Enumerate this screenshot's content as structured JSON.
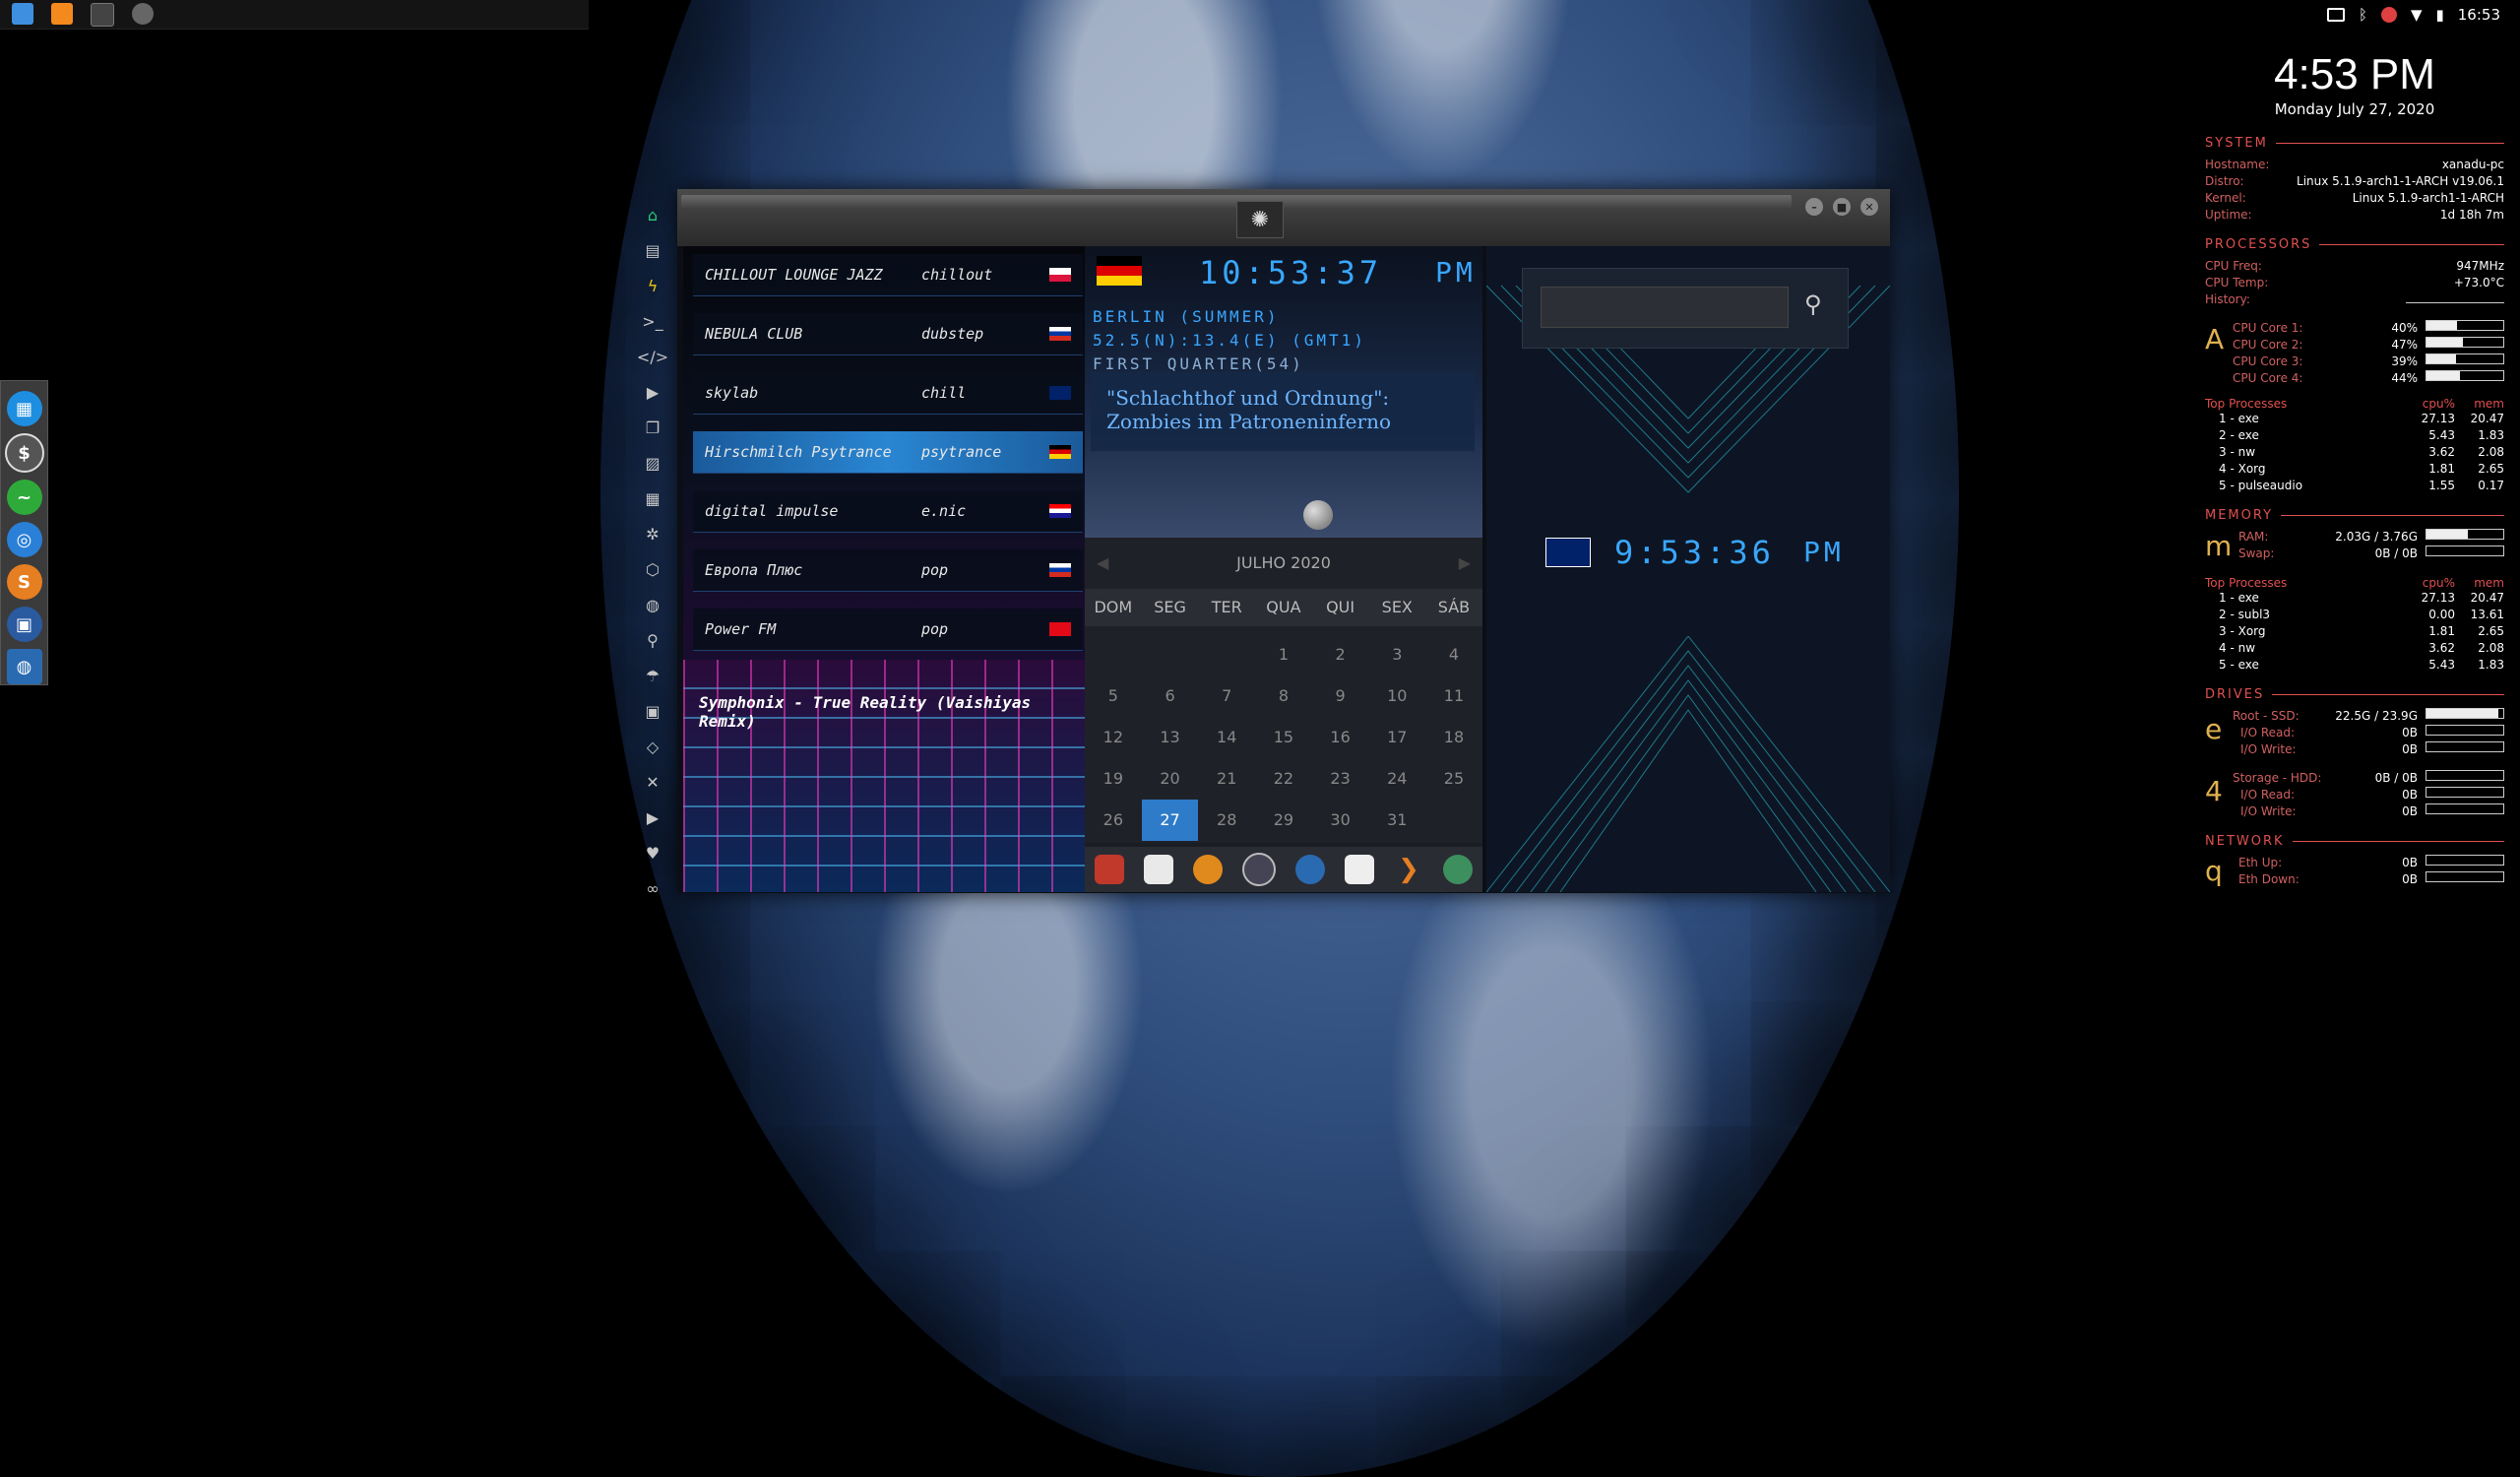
{
  "topbar": {
    "apps": [
      {
        "icon": "file-manager-icon",
        "color": "#3f8fe0"
      },
      {
        "icon": "sublime-text-icon",
        "color": "#f48a1e"
      },
      {
        "icon": "terminal-icon",
        "color": "#444"
      },
      {
        "icon": "app-icon",
        "color": "#666"
      }
    ],
    "tray": {
      "time": "16:53"
    }
  },
  "dock": {
    "items": [
      {
        "icon": "calendar-app-icon",
        "color": "#1e8ee0",
        "glyph": "▦"
      },
      {
        "icon": "dollar-app-icon",
        "color": "#555",
        "glyph": "$"
      },
      {
        "icon": "activity-monitor-icon",
        "color": "#2eaa3a",
        "glyph": "~"
      },
      {
        "icon": "chrome-icon",
        "color": "#2a7fd6",
        "glyph": "◎"
      },
      {
        "icon": "s-app-icon",
        "color": "#e67e22",
        "glyph": "S"
      },
      {
        "icon": "remote-desktop-icon",
        "color": "#2a5aa0",
        "glyph": "▣"
      },
      {
        "icon": "globe-app-icon",
        "color": "#2a6ab0",
        "glyph": "◍"
      }
    ]
  },
  "sidenav": [
    "home-icon",
    "document-icon",
    "bolt-icon",
    "terminal-icon",
    "code-icon",
    "play-icon",
    "copy-icon",
    "image-icon",
    "news-icon",
    "settings-icon",
    "hexagon-icon",
    "globe-icon",
    "search-icon",
    "umbrella-icon",
    "contact-icon",
    "tags-icon",
    "expand-icon",
    "youtube-icon",
    "heart-icon",
    "infinity-icon"
  ],
  "stations": [
    {
      "name": "CHILLOUT LOUNGE JAZZ",
      "genre": "chillout",
      "flag": "pl"
    },
    {
      "name": "NEBULA CLUB",
      "genre": "dubstep",
      "flag": "ru"
    },
    {
      "name": "skylab",
      "genre": "chill",
      "flag": "uk"
    },
    {
      "name": "Hirschmilch Psytrance",
      "genre": "psytrance",
      "flag": "de"
    },
    {
      "name": "digital impulse",
      "genre": "e.nic",
      "flag": "hr"
    },
    {
      "name": "Европа Плюс",
      "genre": "pop",
      "flag": "ru"
    },
    {
      "name": "Power FM",
      "genre": "pop",
      "flag": "tr"
    }
  ],
  "now_playing": "Symphonix - True Reality (Vaishiyas Remix)",
  "berlin": {
    "time": "10:53:37",
    "ampm": "PM",
    "city_line": "BERLIN (SUMMER)",
    "coords_line": "52.5(N):13.4(E) (GMT1)",
    "moon_line": "FIRST QUARTER(54)",
    "headline": "\"Schlachthof und Ordnung\": Zombies im Patroneninferno"
  },
  "calendar": {
    "month": "JULHO 2020",
    "weekdays": [
      "DOM",
      "SEG",
      "TER",
      "QUA",
      "QUI",
      "SEX",
      "SÁB"
    ],
    "rows": [
      [
        "",
        "",
        "",
        "1",
        "2",
        "3",
        "4"
      ],
      [
        "5",
        "6",
        "7",
        "8",
        "9",
        "10",
        "11"
      ],
      [
        "12",
        "13",
        "14",
        "15",
        "16",
        "17",
        "18"
      ],
      [
        "19",
        "20",
        "21",
        "22",
        "23",
        "24",
        "25"
      ],
      [
        "26",
        "27",
        "28",
        "29",
        "30",
        "31",
        ""
      ]
    ],
    "today": "27"
  },
  "appbar": [
    {
      "icon": "atom-icon",
      "color": "#c0392b"
    },
    {
      "icon": "notes-icon",
      "color": "#e9e9e9"
    },
    {
      "icon": "search-app-icon",
      "color": "#e08a1e"
    },
    {
      "icon": "clock-app-icon",
      "color": "#445"
    },
    {
      "icon": "globe-app-icon",
      "color": "#2a6ab0"
    },
    {
      "icon": "calendar-app-icon",
      "color": "#eee"
    },
    {
      "icon": "arrow-app-icon",
      "color": "#e67e22"
    },
    {
      "icon": "yandex-icon",
      "color": "#3e8f5e"
    }
  ],
  "uk": {
    "time": "9:53:36",
    "ampm": "PM"
  },
  "conky": {
    "time": "4:53 PM",
    "date": "Monday July 27, 2020",
    "system": {
      "title": "SYSTEM",
      "rows": [
        [
          "Hostname:",
          "xanadu-pc"
        ],
        [
          "Distro:",
          "Linux 5.1.9-arch1-1-ARCH v19.06.1"
        ],
        [
          "Kernel:",
          "Linux 5.1.9-arch1-1-ARCH"
        ],
        [
          "Uptime:",
          "1d 18h 7m"
        ]
      ]
    },
    "processors": {
      "title": "PROCESSORS",
      "rows": [
        [
          "CPU Freq:",
          "947MHz"
        ],
        [
          "CPU Temp:",
          "+73.0°C"
        ],
        [
          "History:",
          ""
        ]
      ],
      "letter": "A",
      "cores": [
        [
          "CPU Core 1:",
          "40%",
          40
        ],
        [
          "CPU Core 2:",
          "47%",
          47
        ],
        [
          "CPU Core 3:",
          "39%",
          39
        ],
        [
          "CPU Core 4:",
          "44%",
          44
        ]
      ],
      "top_title": "Top Processes",
      "col1": "cpu%",
      "col2": "mem",
      "top": [
        [
          "1 - exe",
          "27.13",
          "20.47"
        ],
        [
          "2 - exe",
          "5.43",
          "1.83"
        ],
        [
          "3 - nw",
          "3.62",
          "2.08"
        ],
        [
          "4 - Xorg",
          "1.81",
          "2.65"
        ],
        [
          "5 - pulseaudio",
          "1.55",
          "0.17"
        ]
      ]
    },
    "memory": {
      "title": "MEMORY",
      "letter": "m",
      "rows": [
        [
          "RAM:",
          "2.03G / 3.76G",
          54
        ],
        [
          "Swap:",
          "0B / 0B",
          0
        ]
      ],
      "top_title": "Top Processes",
      "col1": "cpu%",
      "col2": "mem",
      "top": [
        [
          "1 - exe",
          "27.13",
          "20.47"
        ],
        [
          "2 - subl3",
          "0.00",
          "13.61"
        ],
        [
          "3 - Xorg",
          "1.81",
          "2.65"
        ],
        [
          "4 - nw",
          "3.62",
          "2.08"
        ],
        [
          "5 - exe",
          "5.43",
          "1.83"
        ]
      ]
    },
    "drives": {
      "title": "DRIVES",
      "d1": {
        "letter": "e",
        "label": "Root - SSD:",
        "value": "22.5G / 23.9G",
        "pct": 94,
        "r": [
          "I/O Read:",
          "0B"
        ],
        "w": [
          "I/O Write:",
          "0B"
        ]
      },
      "d2": {
        "letter": "4",
        "label": "Storage - HDD:",
        "value": "0B / 0B",
        "pct": 0,
        "r": [
          "I/O Read:",
          "0B"
        ],
        "w": [
          "I/O Write:",
          "0B"
        ]
      }
    },
    "network": {
      "title": "NETWORK",
      "letter": "q",
      "rows": [
        [
          "Eth Up:",
          "0B"
        ],
        [
          "Eth Down:",
          "0B"
        ]
      ]
    }
  }
}
